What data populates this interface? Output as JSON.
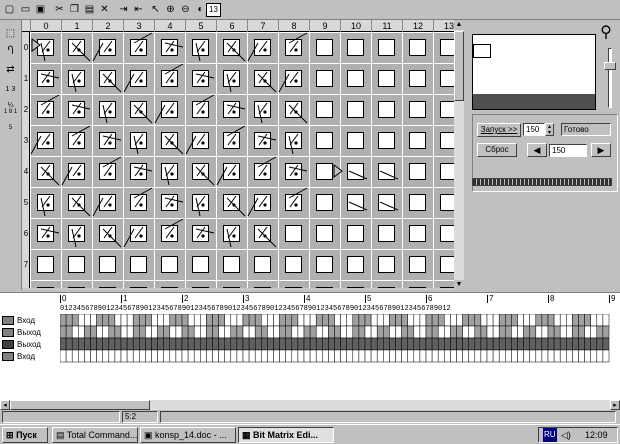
{
  "toolbar": {
    "icons": [
      "new-file-icon",
      "open-file-icon",
      "save-file-icon",
      "cut-icon",
      "copy-icon",
      "paste-icon",
      "delete-icon",
      "export-icon",
      "import-icon",
      "pointer-icon",
      "zoom-in-icon",
      "zoom-out-icon",
      "view-icon"
    ],
    "page_box": "13"
  },
  "left_tools": [
    "1 3 ¼",
    "1 8 1 5"
  ],
  "matrix": {
    "col_labels": [
      "0",
      "1",
      "2",
      "3",
      "4",
      "5",
      "6",
      "7",
      "8",
      "9",
      "10",
      "11",
      "12",
      "13"
    ],
    "row_labels": [
      "0",
      "1",
      "2",
      "3",
      "4",
      "5",
      "6",
      "7"
    ]
  },
  "sim": {
    "start_label": "Запуск >>",
    "start_value": "150",
    "status": "Готово",
    "reset_label": "Сброс",
    "speed_value": "150"
  },
  "timeline": {
    "ruler": [
      "0",
      "1",
      "2",
      "3",
      "4",
      "5",
      "6",
      "7",
      "8",
      "9"
    ],
    "digits": "012345678901234567890123456789012345678901234567890123456789012345678901234567890123456789012",
    "signals": [
      {
        "label": "Вход",
        "color": "#808080"
      },
      {
        "label": "Выход",
        "color": "#808080"
      },
      {
        "label": "Выход",
        "color": "#404040"
      },
      {
        "label": "Вход",
        "color": "#808080"
      }
    ]
  },
  "statusbar": {
    "position": "5:2"
  },
  "taskbar": {
    "start_label": "Пуск",
    "tasks": [
      "Total Command...",
      "konsp_14.doc - ...",
      "Bit Matrix Edi..."
    ],
    "tray_lang": "RU",
    "clock": "12:09"
  }
}
